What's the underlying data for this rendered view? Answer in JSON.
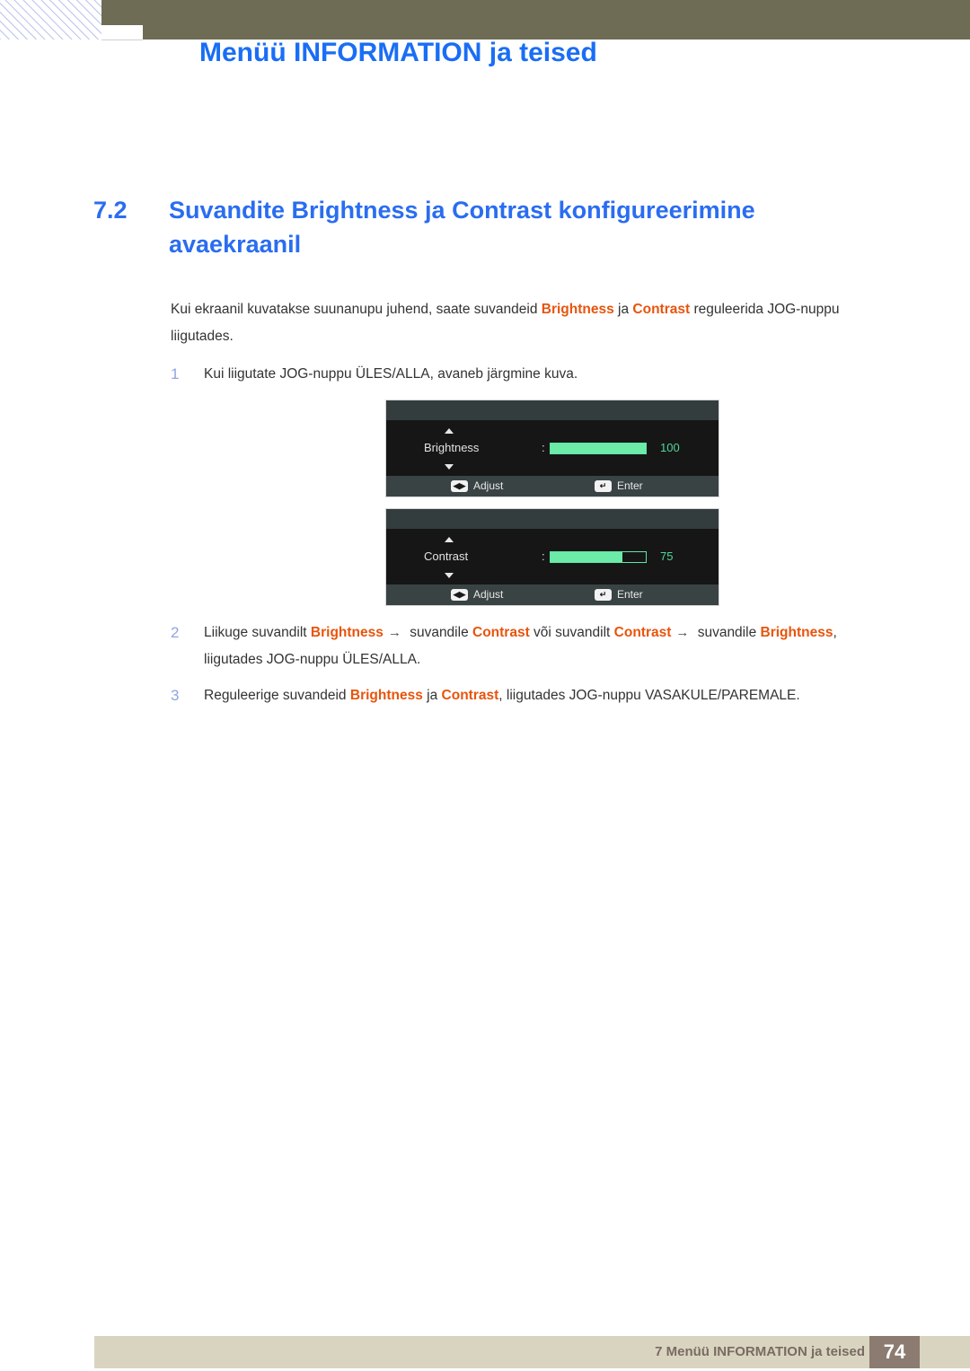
{
  "header": {
    "title": "Menüü INFORMATION ja teised",
    "band_color": "#6e6c55",
    "title_color": "#1a6ef5"
  },
  "section": {
    "number": "7.2",
    "title": "Suvandite Brightness ja Contrast konfigureerimine avaekraanil",
    "color": "#2a6df0"
  },
  "body": {
    "intro": {
      "part1": "Kui ekraanil kuvatakse suunanupu juhend, saate suvandeid ",
      "hl1": "Brightness",
      "part2": " ja ",
      "hl2": "Contrast",
      "part3": " reguleerida JOG-nuppu liigutades."
    },
    "steps": [
      {
        "num": "1",
        "part1": "Kui liigutate JOG-nuppu ÜLES/ALLA, avaneb järgmine kuva.",
        "hl1": "",
        "part2": "",
        "hl2": "",
        "part3": "",
        "hl3": "",
        "part4": ""
      },
      {
        "num": "2",
        "part1": "Liikuge suvandilt ",
        "hl1": "Brightness",
        "arrow1": "→",
        "part2": " suvandile ",
        "hl2": "Contrast",
        "part3": " või suvandilt ",
        "hl3": "Contrast",
        "arrow2": "→",
        "part4": " suvandile ",
        "hl4": "Brightness",
        "part5": ", liigutades JOG-nuppu ÜLES/ALLA."
      },
      {
        "num": "3",
        "part1": "Reguleerige suvandeid ",
        "hl1": "Brightness",
        "part2": " ja ",
        "hl2": "Contrast",
        "part3": ", liigutades JOG-nuppu VASAKULE/PAREMALE."
      }
    ],
    "highlight_color": "#e8540c"
  },
  "osd_panels": [
    {
      "label": "Brightness",
      "colon": ":",
      "value": "100",
      "fill_percent": 100,
      "adjust_label": "Adjust",
      "adjust_icon": "left-right-arrow-icon",
      "adjust_glyph": "◀▶",
      "enter_label": "Enter",
      "enter_icon": "enter-return-icon",
      "enter_glyph": "↵",
      "bar_color": "#6ceaa8",
      "value_color": "#4fd79b"
    },
    {
      "label": "Contrast",
      "colon": ":",
      "value": "75",
      "fill_percent": 75,
      "adjust_label": "Adjust",
      "adjust_icon": "left-right-arrow-icon",
      "adjust_glyph": "◀▶",
      "enter_label": "Enter",
      "enter_icon": "enter-return-icon",
      "enter_glyph": "↵",
      "bar_color": "#6ceaa8",
      "value_color": "#4fd79b"
    }
  ],
  "footer": {
    "text": "7 Menüü INFORMATION ja teised",
    "page": "74",
    "band_color": "#d9d4c0",
    "page_box_color": "#8c7b70"
  }
}
